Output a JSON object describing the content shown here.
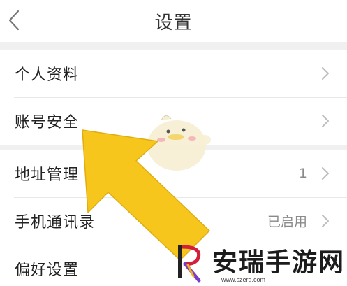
{
  "header": {
    "title": "设置"
  },
  "groups": [
    {
      "items": [
        {
          "label": "个人资料",
          "value": ""
        },
        {
          "label": "账号安全",
          "value": ""
        }
      ]
    },
    {
      "items": [
        {
          "label": "地址管理",
          "value": "1"
        },
        {
          "label": "手机通讯录",
          "value": "已启用"
        },
        {
          "label": "偏好设置",
          "value": ""
        }
      ]
    }
  ],
  "watermark": {
    "text": "安瑞手游网",
    "url": "www.szerg.com"
  },
  "colors": {
    "arrow": "#f7c61d",
    "background": "#f0f0f0",
    "text": "#222222",
    "muted": "#8a8a8a"
  },
  "icons": {
    "back": "chevron-left-icon",
    "row_arrow": "chevron-right-icon"
  }
}
